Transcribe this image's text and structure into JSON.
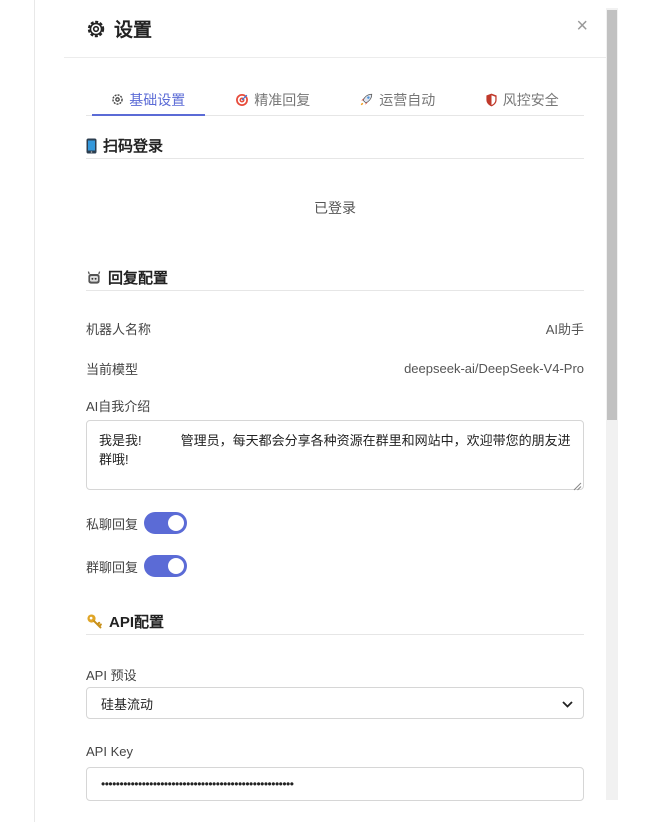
{
  "modal": {
    "title": "设置",
    "close_label": "×"
  },
  "tabs": [
    {
      "label": "基础设置",
      "icon": "gear-icon",
      "active": true
    },
    {
      "label": "精准回复",
      "icon": "target-icon",
      "active": false
    },
    {
      "label": "运营自动",
      "icon": "rocket-icon",
      "active": false
    },
    {
      "label": "风控安全",
      "icon": "shield-icon",
      "active": false
    }
  ],
  "scan_login": {
    "title": "扫码登录",
    "icon": "phone-icon",
    "status": "已登录"
  },
  "reply_config": {
    "title": "回复配置",
    "icon": "robot-icon",
    "bot_name_label": "机器人名称",
    "bot_name_value": "AI助手",
    "model_label": "当前模型",
    "model_value": "deepseek-ai/DeepSeek-V4-Pro",
    "intro_label": "AI自我介绍",
    "intro_value": "我是我!　　　管理员，每天都会分享各种资源在群里和网站中，欢迎带您的朋友进群哦!",
    "private_reply_label": "私聊回复",
    "private_reply_on": true,
    "group_reply_label": "群聊回复",
    "group_reply_on": true
  },
  "api_config": {
    "title": "API配置",
    "icon": "key-icon",
    "preset_label": "API 预设",
    "preset_value": "硅基流动",
    "key_label": "API Key",
    "key_value": "••••••••••••••••••••••••••••••••••••••••••••••••••••"
  },
  "colors": {
    "accent": "#5b6bd6"
  }
}
